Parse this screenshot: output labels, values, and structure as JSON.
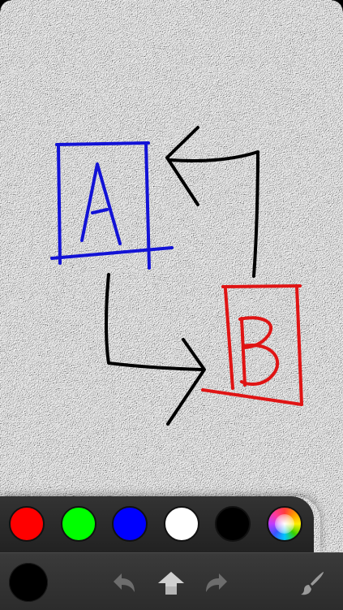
{
  "drawing": {
    "labels": {
      "box_a": "A",
      "box_b": "B"
    },
    "colors": {
      "blue_ink": "#1212d6",
      "red_ink": "#e01414",
      "black_ink": "#000000",
      "paper": "#ececec"
    }
  },
  "palette": {
    "swatches": [
      {
        "name": "red",
        "color": "#ff0000"
      },
      {
        "name": "green",
        "color": "#00ff00"
      },
      {
        "name": "blue",
        "color": "#0000ff"
      },
      {
        "name": "white",
        "color": "#ffffff"
      },
      {
        "name": "black",
        "color": "#000000"
      },
      {
        "name": "color-wheel",
        "color": "wheel"
      }
    ]
  },
  "toolbar": {
    "current_color": "#000000",
    "icons": [
      "undo-icon",
      "clear-icon",
      "redo-icon",
      "brush-icon"
    ]
  }
}
